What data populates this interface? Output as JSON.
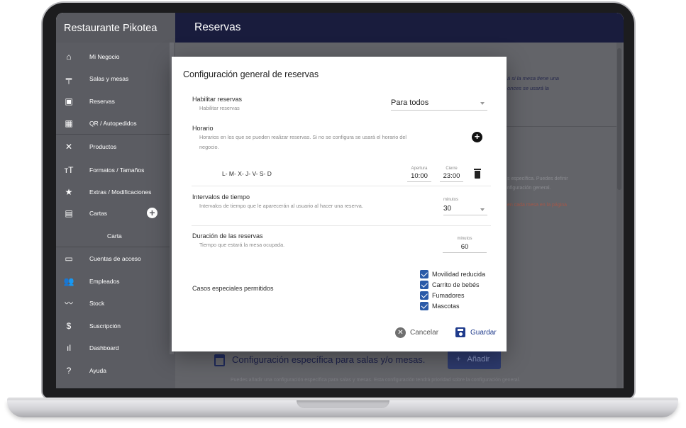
{
  "app": {
    "name": "Restaurante Pikotea",
    "page_title": "Reservas"
  },
  "sidebar": {
    "items": [
      {
        "label": "Mi Negocio",
        "icon": "home-icon"
      },
      {
        "label": "Salas y mesas",
        "icon": "table-icon"
      },
      {
        "label": "Reservas",
        "icon": "calendar-icon"
      },
      {
        "label": "QR / Autopedidos",
        "icon": "qr-icon"
      },
      {
        "label": "Productos",
        "icon": "cutlery-icon"
      },
      {
        "label": "Formatos / Tamaños",
        "icon": "text-size-icon"
      },
      {
        "label": "Extras / Modificaciones",
        "icon": "star-icon"
      },
      {
        "label": "Cartas",
        "icon": "menu-book-icon"
      },
      {
        "label": "Carta",
        "icon": ""
      },
      {
        "label": "Cuentas de acceso",
        "icon": "devices-icon"
      },
      {
        "label": "Empleados",
        "icon": "people-icon"
      },
      {
        "label": "Stock",
        "icon": "trend-icon"
      },
      {
        "label": "Suscripción",
        "icon": "dollar-icon"
      },
      {
        "label": "Dashboard",
        "icon": "bar-chart-icon"
      },
      {
        "label": "Ayuda",
        "icon": "help-icon"
      }
    ]
  },
  "background": {
    "partial_line_1": "á si la mesa tiene una",
    "partial_line_2": "onces se usará la",
    "grey_line_1": "s específica. Puedes definir",
    "grey_line_2": "nfiguración general.",
    "red_line": "en cada mesa en la página",
    "section_title": "Configuración específica para salas y/o mesas.",
    "add_button": "Añadir",
    "bottom_text": "Puedes añadir una configuración específica para salas y mesas. Esta configuración tendrá prioridad sobre la configuración general."
  },
  "modal": {
    "title": "Configuración general de reservas",
    "habilitar": {
      "label": "Habilitar reservas",
      "help": "Habilitar reservas",
      "value": "Para todos"
    },
    "horario": {
      "label": "Horario",
      "help_line_1": "Horarios en los que se pueden realizar reservas. Si no se configura se usará el horario del",
      "help_line_2": "negocio.",
      "days": "L- M- X- J- V- S- D",
      "apertura_label": "Apertura",
      "apertura_value": "10:00",
      "cierre_label": "Cierre",
      "cierre_value": "23:00"
    },
    "intervalos": {
      "label": "Intervalos de tiempo",
      "help": "Intervalos de tiempo que le aparecerán al usuario al hacer una reserva.",
      "unit": "minutos",
      "value": "30"
    },
    "duracion": {
      "label": "Duración de las reservas",
      "help": "Tiempo que estará la mesa ocupada.",
      "unit": "minutos",
      "value": "60"
    },
    "casos": {
      "label": "Casos especiales permitidos",
      "options": [
        {
          "label": "Movilidad reducida",
          "checked": true
        },
        {
          "label": "Carrito de bebés",
          "checked": true
        },
        {
          "label": "Fumadores",
          "checked": true
        },
        {
          "label": "Mascotas",
          "checked": true
        }
      ]
    },
    "cancel_label": "Cancelar",
    "save_label": "Guardar"
  }
}
